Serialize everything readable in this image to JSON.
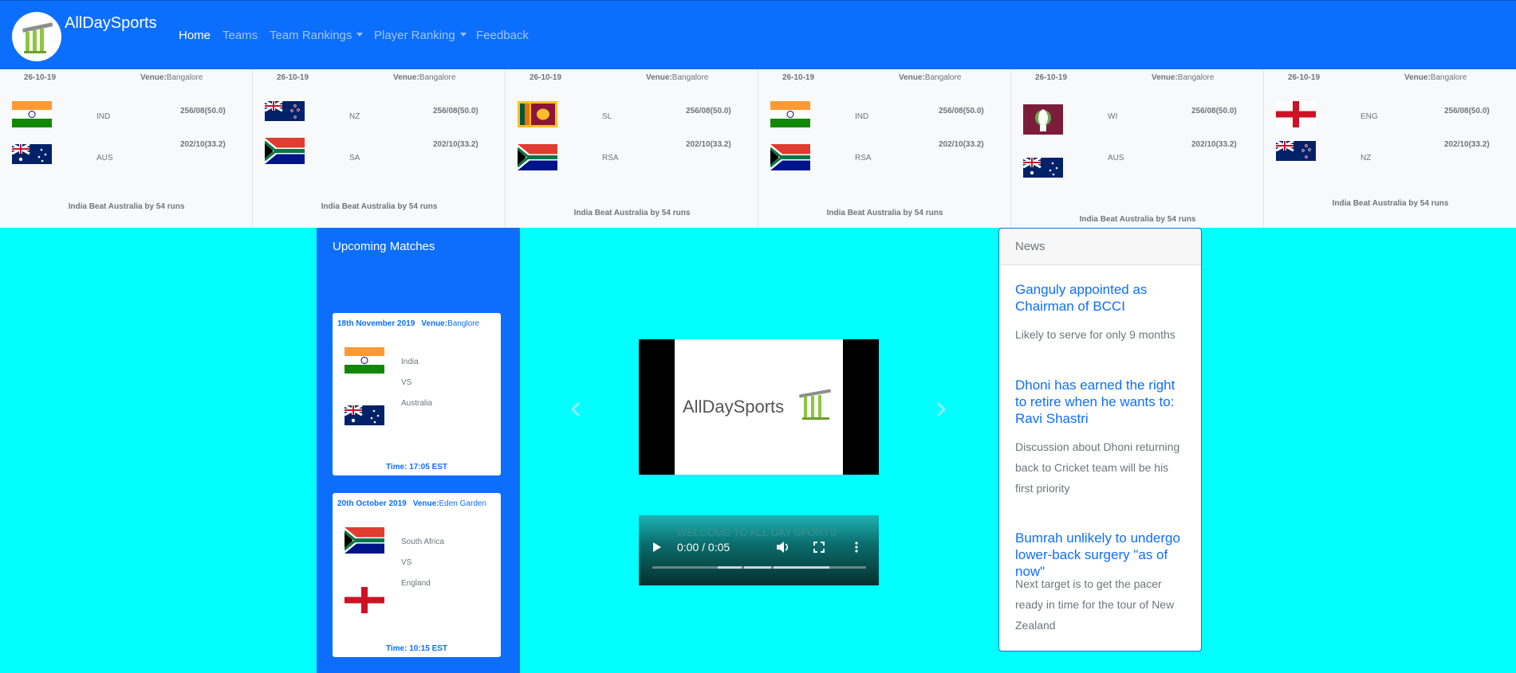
{
  "navbar": {
    "brand": "AllDaySports",
    "items": [
      {
        "label": "Home",
        "active": true
      },
      {
        "label": "Teams"
      },
      {
        "label": "Team Rankings",
        "dropdown": true
      },
      {
        "label": "Player Ranking",
        "dropdown": true
      },
      {
        "label": "Feedback"
      }
    ]
  },
  "scores": [
    {
      "date": "26-10-19",
      "venue_label": "Venue:",
      "venue": "Bangalore",
      "team1": {
        "code": "IND",
        "flag": "india-flag",
        "score": "256/08(50.0)"
      },
      "team2": {
        "code": "AUS",
        "flag": "australia-flag",
        "score": "202/10(33.2)"
      },
      "result": "India Beat Australia by 54 runs"
    },
    {
      "date": "26-10-19",
      "venue_label": "Venue:",
      "venue": "Bangalore",
      "team1": {
        "code": "NZ",
        "flag": "new-zealand-flag",
        "score": "256/08(50.0)"
      },
      "team2": {
        "code": "SA",
        "flag": "south-africa-flag",
        "score": "202/10(33.2)"
      },
      "result": "India Beat Australia by 54 runs"
    },
    {
      "date": "26-10-19",
      "venue_label": "Venue:",
      "venue": "Bangalore",
      "team1": {
        "code": "SL",
        "flag": "sri-lanka-flag",
        "score": "256/08(50.0)"
      },
      "team2": {
        "code": "RSA",
        "flag": "south-africa-flag",
        "score": "202/10(33.2)"
      },
      "result": "India Beat Australia by 54 runs"
    },
    {
      "date": "26-10-19",
      "venue_label": "Venue:",
      "venue": "Bangalore",
      "team1": {
        "code": "IND",
        "flag": "india-flag",
        "score": "256/08(50.0)"
      },
      "team2": {
        "code": "RSA",
        "flag": "south-africa-flag",
        "score": "202/10(33.2)"
      },
      "result": "India Beat Australia by 54 runs"
    },
    {
      "date": "26-10-19",
      "venue_label": "Venue:",
      "venue": "Bangalore",
      "team1": {
        "code": "WI",
        "flag": "west-indies-flag",
        "score": "256/08(50.0)"
      },
      "team2": {
        "code": "AUS",
        "flag": "australia-flag",
        "score": "202/10(33.2)"
      },
      "result": "India Beat Australia by 54 runs"
    },
    {
      "date": "26-10-19",
      "venue_label": "Venue:",
      "venue": "Bangalore",
      "team1": {
        "code": "ENG",
        "flag": "england-flag",
        "score": "256/08(50.0)"
      },
      "team2": {
        "code": "NZ",
        "flag": "new-zealand-flag",
        "score": "202/10(33.2)"
      },
      "result": "India Beat Australia by 54 runs"
    }
  ],
  "upcoming": {
    "title": "Upcoming Matches",
    "matches": [
      {
        "date": "18th November 2019",
        "venue_label": "Venue:",
        "venue": "Banglore",
        "team1": "India",
        "vs": "VS",
        "team2": "Australia",
        "time": "Time: 17:05 EST"
      },
      {
        "date": "20th October 2019",
        "venue_label": "Venue:",
        "venue": "Eden Garden",
        "team1": "South Africa",
        "vs": "VS",
        "team2": "England",
        "time": "Time: 10:15 EST"
      }
    ]
  },
  "carousel": {
    "prev_icon": "chevron-left-icon",
    "next_icon": "chevron-right-icon",
    "slide_logo": "AllDaySports"
  },
  "video": {
    "caption": "WELCOME TO ALL DAY SPORTS",
    "time": "0:00 / 0:05"
  },
  "news": {
    "title": "News",
    "items": [
      {
        "headline": "Ganguly appointed as Chairman of BCCI",
        "summary": "Likely to serve for only 9 months"
      },
      {
        "headline": "Dhoni has earned the right to retire when he wants to: Ravi Shastri",
        "summary": "Discussion about Dhoni returning back to Cricket team will be his first priority"
      },
      {
        "headline": "Bumrah unlikely to undergo lower-back surgery \"as of now\"",
        "summary": "Next target is to get the pacer ready in time for the tour of New Zealand"
      }
    ]
  }
}
